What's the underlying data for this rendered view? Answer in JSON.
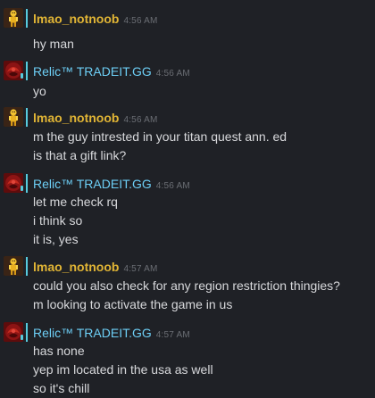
{
  "messages": [
    {
      "sender": "lmao_notnoob",
      "time": "4:56 AM",
      "lines": [
        "hy man"
      ]
    },
    {
      "sender": "Relic™ TRADEIT.GG",
      "time": "4:56 AM",
      "lines": [
        "yo"
      ]
    },
    {
      "sender": "lmao_notnoob",
      "time": "4:56 AM",
      "lines": [
        "m the guy intrested in your titan quest ann. ed",
        "is that a gift link?"
      ]
    },
    {
      "sender": "Relic™ TRADEIT.GG",
      "time": "4:56 AM",
      "lines": [
        "let me check rq",
        "i think so",
        "it is, yes"
      ]
    },
    {
      "sender": "lmao_notnoob",
      "time": "4:57 AM",
      "lines": [
        "could you also check for any region restriction thingies?",
        "m looking to activate the game in us"
      ]
    },
    {
      "sender": "Relic™ TRADEIT.GG",
      "time": "4:57 AM",
      "lines": [
        "has none",
        "yep im located in the usa as well",
        "so it's chill"
      ]
    }
  ],
  "colors": {
    "background": "#1f2126",
    "self_name": "#e1b535",
    "friend_name": "#6dcff6",
    "online_indicator": "#57cbde",
    "message_text": "#d8d9dc",
    "timestamp": "#6b6e74"
  },
  "icons": {
    "self_avatar": "yellow-figure-avatar-icon",
    "friend_avatar": "red-emblem-avatar-icon"
  }
}
